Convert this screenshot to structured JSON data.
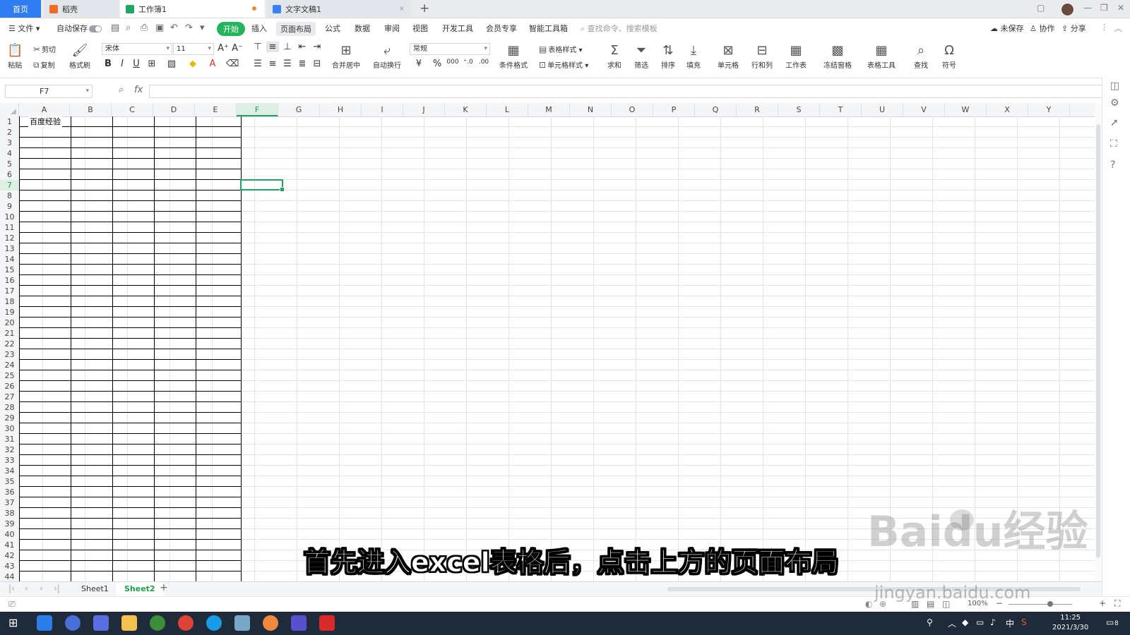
{
  "tabs": {
    "home": "首页",
    "items": [
      {
        "label": "稻壳"
      },
      {
        "label": "工作簿1"
      },
      {
        "label": "文字文稿1"
      }
    ]
  },
  "menu": {
    "file": "文件",
    "autosave": "自动保存",
    "items": [
      "开始",
      "插入",
      "页面布局",
      "公式",
      "数据",
      "审阅",
      "视图",
      "开发工具",
      "会员专享",
      "智能工具箱"
    ],
    "active": "开始",
    "hover": "页面布局",
    "search_placeholder": "查找命令、搜索模板",
    "unsaved": "未保存",
    "collab": "协作",
    "share": "分享"
  },
  "ribbon": {
    "paste": "粘贴",
    "cut": "剪切",
    "copy": "复制",
    "format_painter": "格式刷",
    "font_name": "宋体",
    "font_size": "11",
    "merge_center": "合并居中",
    "wrap_text": "自动换行",
    "number_format": "常规",
    "cond_format": "条件格式",
    "table_style": "表格样式",
    "cell_style": "单元格样式",
    "sum": "求和",
    "filter": "筛选",
    "sort": "排序",
    "fill": "填充",
    "cell": "单元格",
    "row_col": "行和列",
    "worksheet": "工作表",
    "freeze": "冻结窗格",
    "table_tools": "表格工具",
    "find": "查找",
    "symbol": "符号"
  },
  "formula_bar": {
    "name_box": "F7",
    "fx": "fx",
    "content": ""
  },
  "grid": {
    "columns": [
      "A",
      "B",
      "C",
      "D",
      "E",
      "F",
      "G",
      "H",
      "I",
      "J",
      "K",
      "L",
      "M",
      "N",
      "O",
      "P",
      "Q",
      "R",
      "S",
      "T",
      "U",
      "V",
      "W",
      "X",
      "Y"
    ],
    "selected_column": "F",
    "selected_row": 7,
    "row_count": 44,
    "cell_a1": "百度经验"
  },
  "sheets": {
    "tabs": [
      "Sheet1",
      "Sheet2"
    ],
    "active": "Sheet2"
  },
  "statusbar": {
    "zoom": "100%"
  },
  "overlay": {
    "subtitle": "首先进入excel表格后，点击上方的页面布局",
    "watermark": "Baidu经验",
    "watermark_url": "jingyan.baidu.com"
  },
  "taskbar": {
    "time": "11:25",
    "date": "2021/3/30",
    "ime": "中",
    "notification_count": "8"
  },
  "colors": {
    "accent_green": "#21a366",
    "tab_home_blue": "#2f7bf0",
    "taskbar": "#1f2a3a"
  }
}
